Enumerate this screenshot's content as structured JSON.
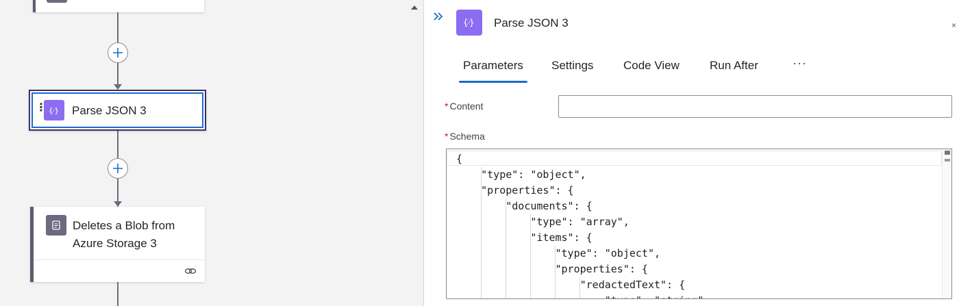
{
  "canvas": {
    "nodes": [
      {
        "id": "top-action",
        "title": ""
      },
      {
        "id": "parse-json-3",
        "title": "Parse JSON 3",
        "icon": "braces-icon",
        "selected": true
      },
      {
        "id": "delete-blob-3",
        "title": "Deletes a Blob from Azure Storage 3",
        "title_line1": "Deletes a Blob from",
        "title_line2": "Azure Storage 3",
        "icon": "blob-icon"
      }
    ],
    "add_step_icon": "plus-icon",
    "colors": {
      "parse_tile": "#8c6cf0",
      "blob_tile": "#6e6880",
      "selection": "#1b6ac9"
    }
  },
  "panel": {
    "title": "Parse JSON 3",
    "collapse_icon": "double-chevron-right-icon",
    "tabs": [
      {
        "label": "Parameters",
        "active": true
      },
      {
        "label": "Settings",
        "active": false
      },
      {
        "label": "Code View",
        "active": false
      },
      {
        "label": "Run After",
        "active": false
      }
    ],
    "tabs_more": "···",
    "fields": {
      "content": {
        "label": "Content",
        "required_mark": "*",
        "value": ""
      },
      "schema": {
        "label": "Schema",
        "required_mark": "*",
        "code": "{\n    \"type\": \"object\",\n    \"properties\": {\n        \"documents\": {\n            \"type\": \"array\",\n            \"items\": {\n                \"type\": \"object\",\n                \"properties\": {\n                    \"redactedText\": {\n                        \"type\": \"string\""
      }
    }
  }
}
